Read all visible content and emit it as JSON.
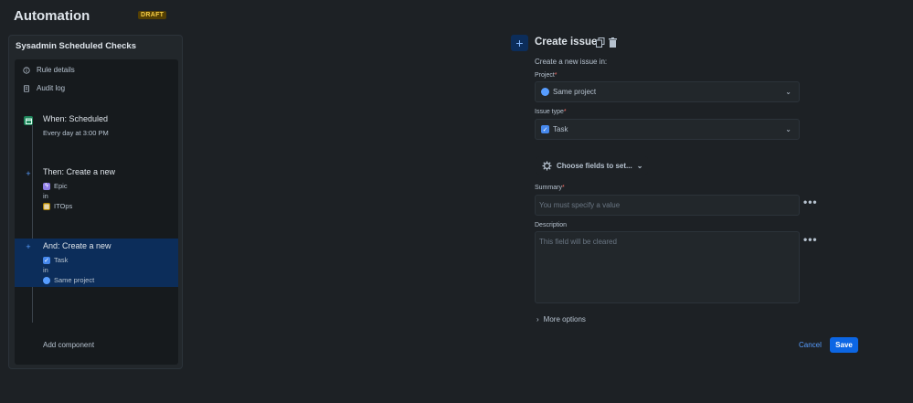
{
  "header": {
    "title": "Automation",
    "badge": "DRAFT"
  },
  "sidebar": {
    "rule_name": "Sysadmin Scheduled Checks",
    "meta": [
      {
        "label": "Rule details",
        "icon": "info-icon"
      },
      {
        "label": "Audit log",
        "icon": "audit-log-icon"
      }
    ],
    "components": [
      {
        "title": "When: Scheduled",
        "lines": [
          "Every day at 3:00 PM"
        ],
        "icon": "calendar-icon"
      },
      {
        "title": "Then: Create a new",
        "lines": [
          "Epic",
          "in",
          "ITOps"
        ],
        "icon": "plus-icon"
      },
      {
        "title": "And: Create a new",
        "lines": [
          "Task",
          "in",
          "Same project"
        ],
        "icon": "plus-icon"
      }
    ],
    "add_component": "Add component"
  },
  "form": {
    "title": "Create issue",
    "subtitle": "Create a new issue in:",
    "project": {
      "label": "Project",
      "value": "Same project"
    },
    "issue_type": {
      "label": "Issue type",
      "value": "Task"
    },
    "choose_fields": "Choose fields to set...",
    "summary": {
      "label": "Summary",
      "placeholder": "You must specify a value"
    },
    "description": {
      "label": "Description",
      "placeholder": "This field will be cleared"
    },
    "more_options": "More options",
    "dots": "•••",
    "cancel": "Cancel",
    "save": "Save"
  },
  "colors": {
    "background": "#1d2125",
    "accent": "#0c66e4",
    "selected": "#0c2d5a",
    "required": "#f87168",
    "link": "#579dff"
  }
}
